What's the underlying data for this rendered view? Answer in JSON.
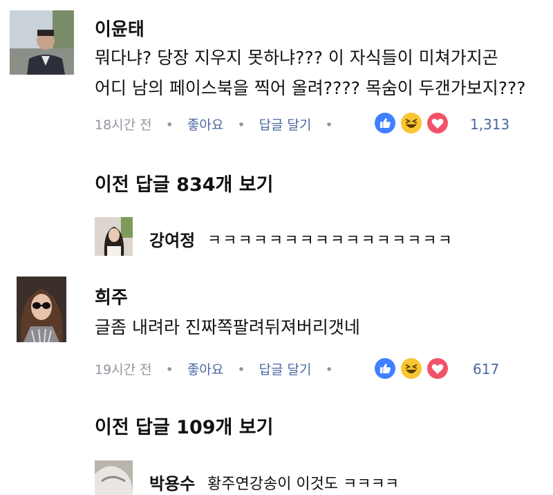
{
  "comments": [
    {
      "author": "이윤태",
      "text_line1": "뭐다냐? 당장 지우지 못하냐??? 이 자식들이 미쳐가지곤",
      "text_line2": "어디 남의 페이스북을 찍어 올려???? 목숨이 두갠가보지???",
      "time": "18시간 전",
      "like_label": "좋아요",
      "reply_label": "답글 달기",
      "reaction_count": "1,313",
      "reactions": [
        "like-icon",
        "haha-icon",
        "love-icon"
      ]
    },
    {
      "author": "희주",
      "text": "글좀 내려라 진짜쪽팔려뒤져버리갯네",
      "time": "19시간 전",
      "like_label": "좋아요",
      "reply_label": "답글 달기",
      "reaction_count": "617",
      "reactions": [
        "like-icon",
        "haha-icon",
        "love-icon"
      ]
    }
  ],
  "view_more_1": "이전 답글 834개 보기",
  "view_more_2": "이전 답글 109개 보기",
  "replies": [
    {
      "author": "강여정",
      "text": "ㅋㅋㅋㅋㅋㅋㅋㅋㅋㅋㅋㅋㅋㅋㅋㅋ"
    },
    {
      "author": "박용수",
      "text": "황주연강송이 이것도 ㅋㅋㅋㅋ"
    }
  ],
  "colors": {
    "link": "#4b67a1",
    "meta": "#90949c",
    "like": "#4080ff",
    "haha": "#f7c632",
    "love": "#f25268"
  }
}
